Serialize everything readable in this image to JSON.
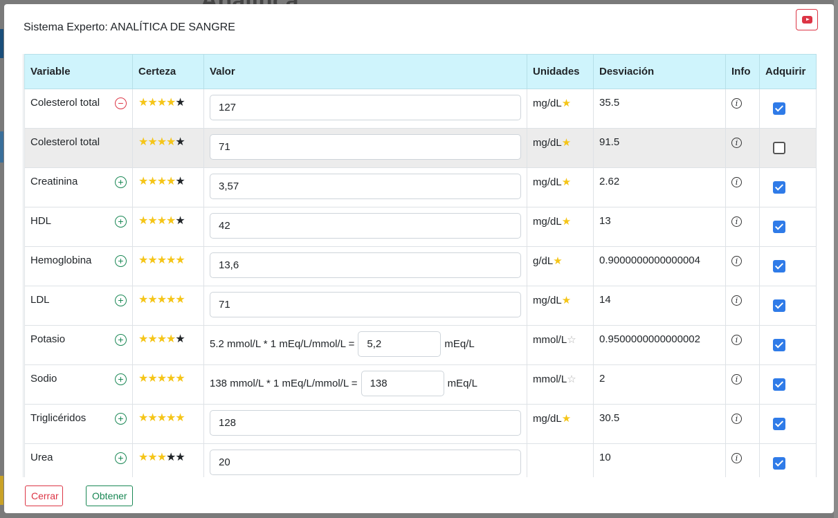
{
  "background": {
    "title": "Analítica"
  },
  "modal": {
    "title": "Sistema Experto: ANALÍTICA DE SANGRE",
    "youtube_icon": "youtube-icon"
  },
  "table": {
    "headers": [
      "Variable",
      "Certeza",
      "Valor",
      "Unidades",
      "Desviación",
      "Info",
      "Adquirir"
    ],
    "rows": [
      {
        "variable": "Colesterol total",
        "action": "minus",
        "stars": 4,
        "value": "127",
        "units": "mg/dL",
        "unit_star": "filled",
        "deviation": "35.5",
        "checked": true,
        "gray": false
      },
      {
        "variable": "Colesterol total",
        "action": "none",
        "stars": 4,
        "value": "71",
        "units": "mg/dL",
        "unit_star": "filled",
        "deviation": "91.5",
        "checked": false,
        "gray": true
      },
      {
        "variable": "Creatinina",
        "action": "plus",
        "stars": 4,
        "value": "3,57",
        "units": "mg/dL",
        "unit_star": "filled",
        "deviation": "2.62",
        "checked": true,
        "gray": false
      },
      {
        "variable": "HDL",
        "action": "plus",
        "stars": 4,
        "value": "42",
        "units": "mg/dL",
        "unit_star": "filled",
        "deviation": "13",
        "checked": true,
        "gray": false
      },
      {
        "variable": "Hemoglobina",
        "action": "plus",
        "stars": 5,
        "value": "13,6",
        "units": "g/dL",
        "unit_star": "filled",
        "deviation": "0.9000000000000004",
        "checked": true,
        "gray": false
      },
      {
        "variable": "LDL",
        "action": "plus",
        "stars": 5,
        "value": "71",
        "units": "mg/dL",
        "unit_star": "filled",
        "deviation": "14",
        "checked": true,
        "gray": false
      },
      {
        "variable": "Potasio",
        "action": "plus",
        "stars": 4,
        "conversion_prefix": "5.2 mmol/L * 1 mEq/L/mmol/L =",
        "value": "5,2",
        "conversion_suffix": "mEq/L",
        "units": "mmol/L",
        "unit_star": "empty",
        "deviation": "0.9500000000000002",
        "checked": true,
        "gray": false
      },
      {
        "variable": "Sodio",
        "action": "plus",
        "stars": 5,
        "conversion_prefix": "138 mmol/L * 1 mEq/L/mmol/L =",
        "value": "138",
        "conversion_suffix": "mEq/L",
        "units": "mmol/L",
        "unit_star": "empty",
        "deviation": "2",
        "checked": true,
        "gray": false
      },
      {
        "variable": "Triglicéridos",
        "action": "plus",
        "stars": 5,
        "value": "128",
        "units": "mg/dL",
        "unit_star": "filled",
        "deviation": "30.5",
        "checked": true,
        "gray": false
      },
      {
        "variable": "Urea",
        "action": "plus",
        "stars": 3,
        "value": "20",
        "units": "",
        "unit_star": "none",
        "deviation": "10",
        "checked": true,
        "gray": false
      }
    ]
  },
  "footer": {
    "close_label": "Cerrar",
    "get_label": "Obtener"
  },
  "colors": {
    "header_bg": "#cff4fc",
    "star_on": "#f5c518",
    "checkbox": "#2f7be8",
    "danger": "#dc3545",
    "success": "#198754"
  }
}
